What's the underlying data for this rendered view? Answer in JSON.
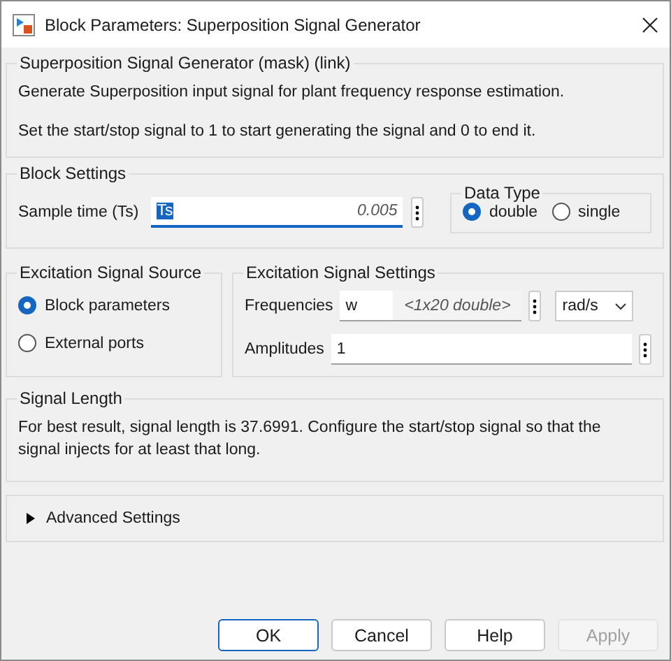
{
  "window": {
    "title": "Block Parameters: Superposition Signal Generator"
  },
  "mask": {
    "title": "Superposition Signal Generator (mask) (link)",
    "paragraphs": [
      "Generate Superposition input signal for plant frequency response estimation.",
      "Set the start/stop signal to 1 to start generating the signal and 0 to end it."
    ]
  },
  "block_settings": {
    "title": "Block Settings",
    "sample_time": {
      "label": "Sample time (Ts)",
      "value": "Ts",
      "value_highlighted": true,
      "hint": "0.005"
    },
    "data_type": {
      "title": "Data Type",
      "options": [
        {
          "label": "double",
          "selected": true
        },
        {
          "label": "single",
          "selected": false
        }
      ]
    }
  },
  "excitation_source": {
    "title": "Excitation Signal Source",
    "options": [
      {
        "label": "Block parameters",
        "selected": true
      },
      {
        "label": "External ports",
        "selected": false
      }
    ]
  },
  "excitation_settings": {
    "title": "Excitation Signal Settings",
    "frequencies": {
      "label": "Frequencies",
      "value": "w",
      "hint": "<1x20 double>",
      "unit": "rad/s"
    },
    "amplitudes": {
      "label": "Amplitudes",
      "value": "1"
    }
  },
  "signal_length": {
    "title": "Signal Length",
    "text": "For best result, signal length is 37.6991.  Configure the start/stop signal so that the signal injects for at least that long."
  },
  "advanced": {
    "label": "Advanced Settings",
    "expanded": false
  },
  "buttons": [
    {
      "label": "OK",
      "default": true,
      "disabled": false
    },
    {
      "label": "Cancel",
      "default": false,
      "disabled": false
    },
    {
      "label": "Help",
      "default": false,
      "disabled": false
    },
    {
      "label": "Apply",
      "default": false,
      "disabled": true
    }
  ]
}
